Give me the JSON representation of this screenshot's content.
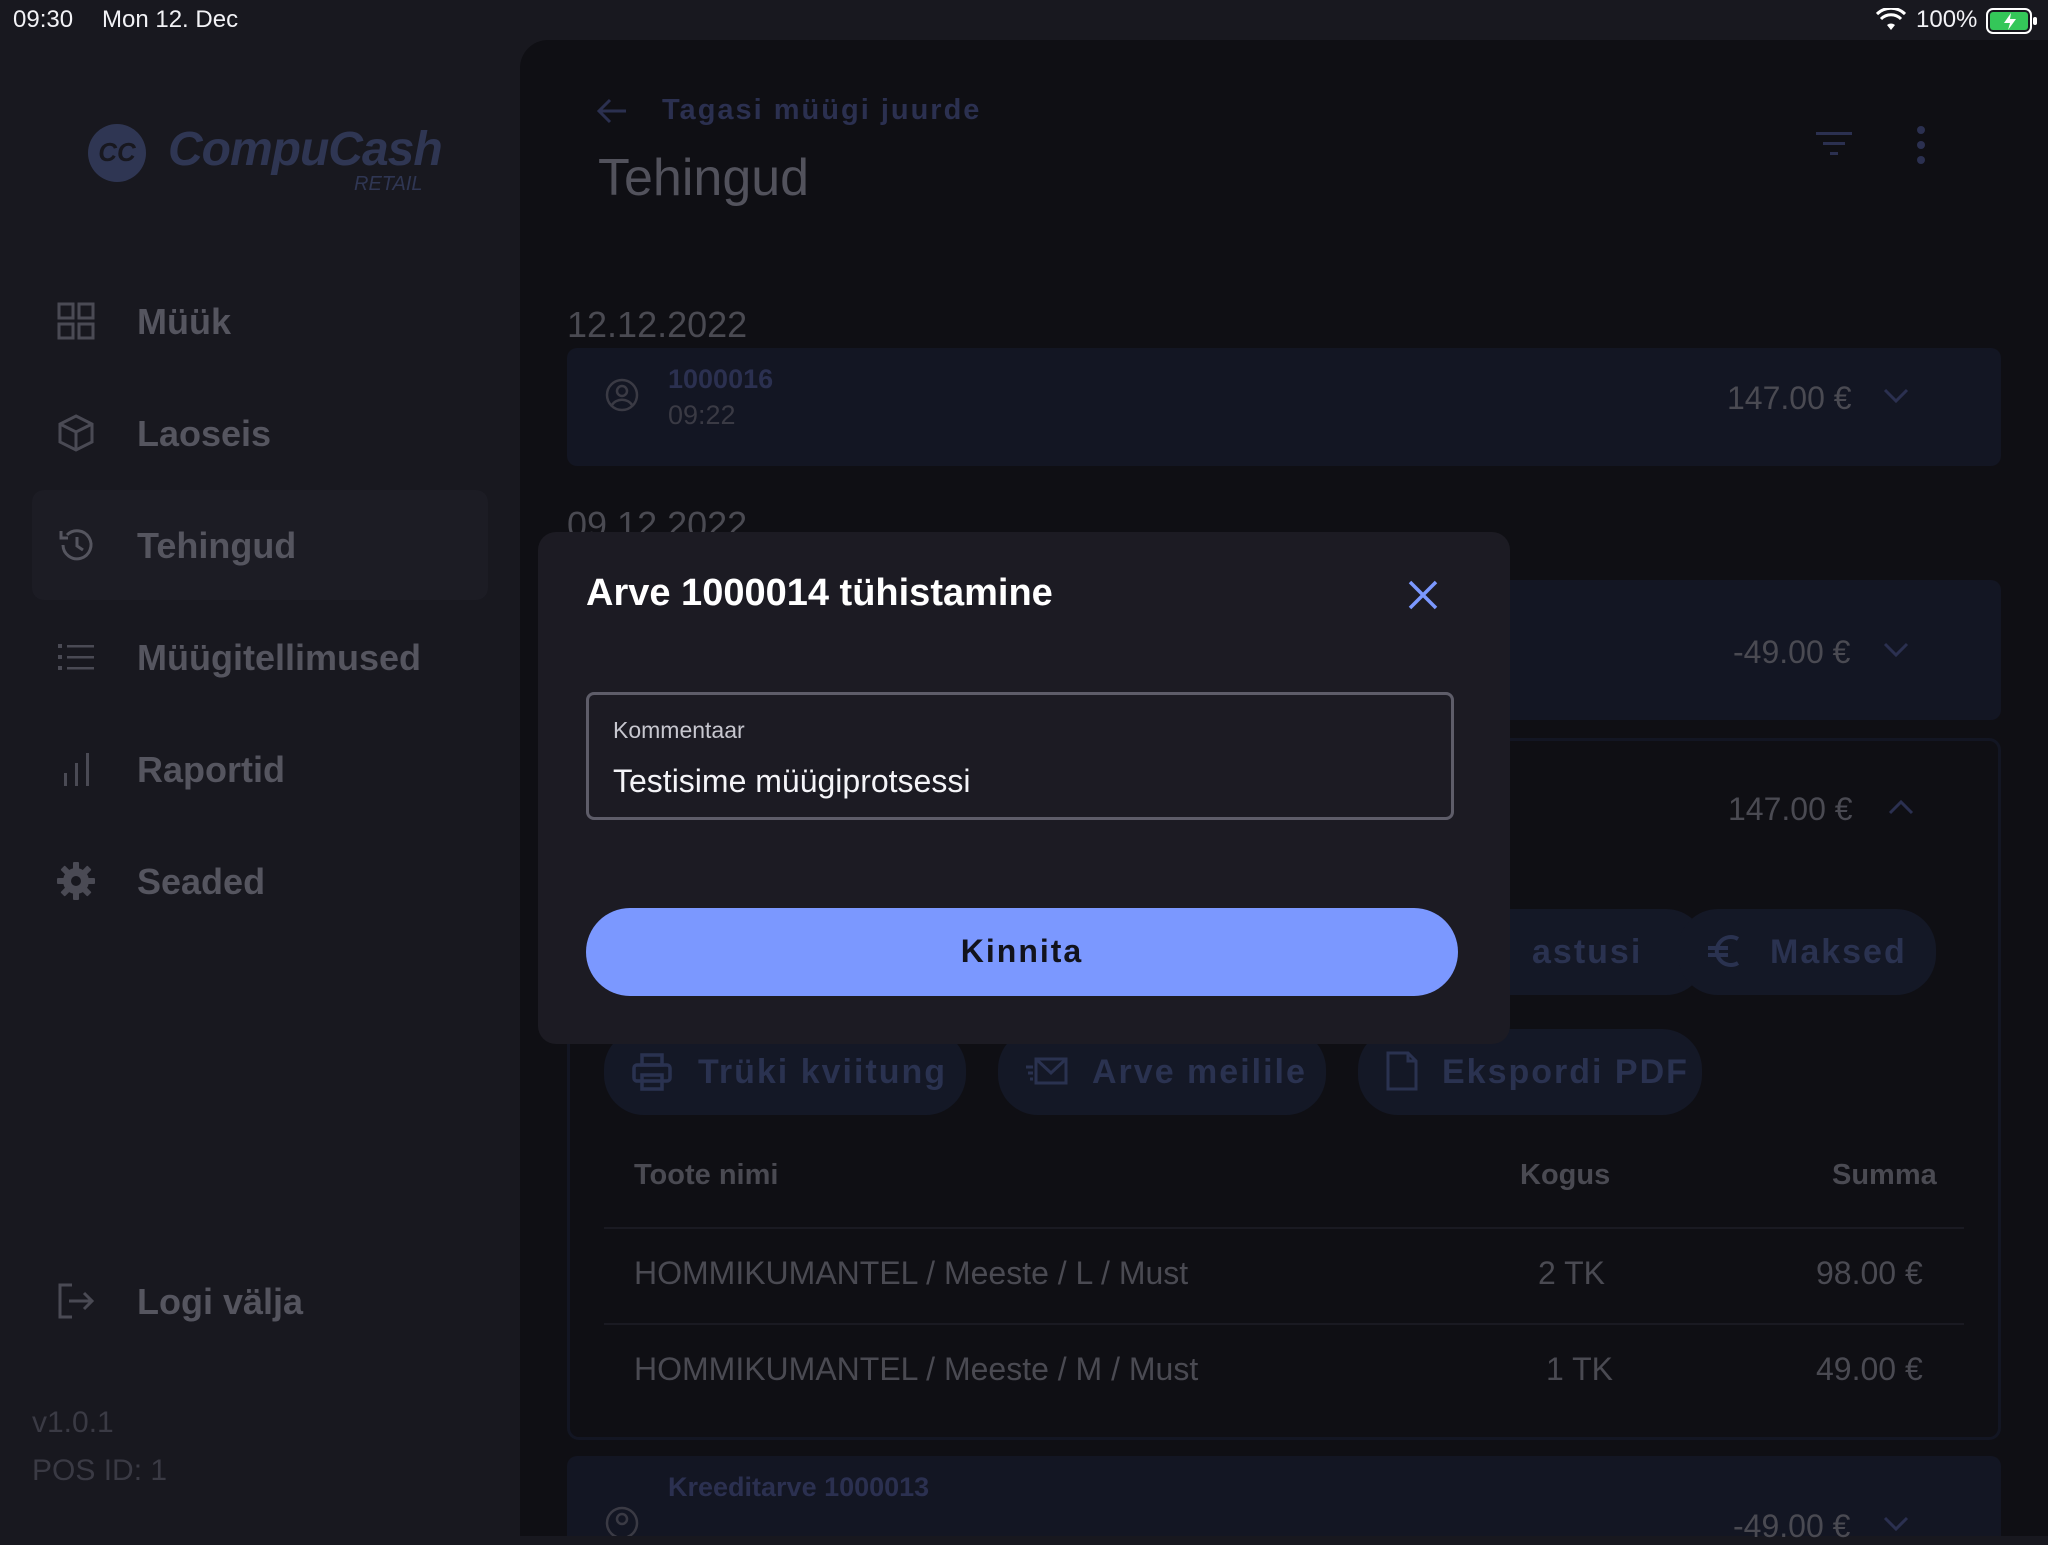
{
  "status_bar": {
    "time": "09:30",
    "date": "Mon 12. Dec",
    "battery": "100%"
  },
  "sidebar": {
    "logo": {
      "mark": "CC",
      "name": "CompuCash",
      "sub": "RETAIL"
    },
    "items": [
      {
        "label": "Müük",
        "icon": "grid-icon"
      },
      {
        "label": "Laoseis",
        "icon": "box-icon"
      },
      {
        "label": "Tehingud",
        "icon": "history-icon",
        "active": true
      },
      {
        "label": "Müügitellimused",
        "icon": "list-icon"
      },
      {
        "label": "Raportid",
        "icon": "bar-chart-icon"
      },
      {
        "label": "Seaded",
        "icon": "gear-icon"
      }
    ],
    "logout": "Logi välja",
    "version": "v1.0.1",
    "pos_id": "POS ID: 1"
  },
  "main": {
    "back": "Tagasi müügi juurde",
    "title": "Tehingud",
    "groups": [
      {
        "date": "12.12.2022",
        "txn": {
          "number": "1000016",
          "time": "09:22",
          "amount": "147.00 €"
        }
      },
      {
        "date": "09.12.2022"
      }
    ],
    "amount_2": "-49.00 €",
    "amount_3": "147.00 €",
    "actions_row1": {
      "a": "astusi",
      "b": "Maksed"
    },
    "actions_row2": {
      "print": "Trüki kviitung",
      "email": "Arve meilile",
      "pdf": "Ekspordi PDF"
    },
    "table": {
      "headers": {
        "name": "Toote nimi",
        "qty": "Kogus",
        "sum": "Summa"
      },
      "rows": [
        {
          "name": "HOMMIKUMANTEL / Meeste / L / Must",
          "qty": "2 TK",
          "sum": "98.00 €"
        },
        {
          "name": "HOMMIKUMANTEL / Meeste / M / Must",
          "qty": "1 TK",
          "sum": "49.00 €"
        }
      ]
    },
    "bottom_txn": {
      "number": "Kreeditarve 1000013",
      "amount": "-49.00 €"
    }
  },
  "modal": {
    "title": "Arve 1000014 tühistamine",
    "comment_label": "Kommentaar",
    "comment_value": "Testisime müügiprotsessi",
    "confirm": "Kinnita"
  },
  "colors": {
    "accent": "#7b98ff",
    "background": "#0f0f14",
    "modal": "#1c1b23"
  }
}
